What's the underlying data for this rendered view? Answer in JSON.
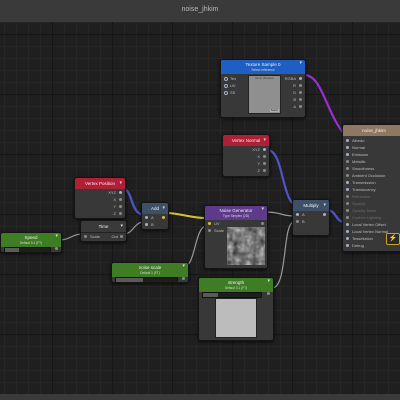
{
  "window": {
    "title": "noise_jhkim"
  },
  "nodes": {
    "texture_sample": {
      "title": "Texture Sample 0",
      "subtitle": "Select reference",
      "inputs": [
        "Tex",
        "UV",
        "SS"
      ],
      "outputs": [
        "RGBA",
        "R",
        "G",
        "B",
        "A"
      ],
      "preview_label": "None (Texture)",
      "select_label": "Select"
    },
    "output": {
      "title": "noise_jhkim",
      "inputs": [
        "Albedo",
        "Normal",
        "Emission",
        "Metallic",
        "Smoothness",
        "Ambient Occlusion",
        "Transmission",
        "Translucency",
        "Refraction",
        "Opacity",
        "Opacity Mask",
        "Custom Lighting",
        "Local Vertex Offset",
        "Local Vertex Normal",
        "Tessellation",
        "Debug"
      ]
    },
    "vertex_normal": {
      "title": "Vertex Normal",
      "outputs": [
        "XYZ",
        "X",
        "Y",
        "Z"
      ]
    },
    "vertex_position": {
      "title": "Vertex Position",
      "outputs": [
        "XYZ",
        "X",
        "Y",
        "Z"
      ]
    },
    "add": {
      "title": "Add",
      "inputs": [
        "A",
        "B"
      ]
    },
    "time": {
      "title": "Time",
      "input": "Scale",
      "output": "Out"
    },
    "speed": {
      "title": "Speed",
      "subtitle": "Default 0.1 (FT)"
    },
    "noise_generator": {
      "title": "Noise Generator",
      "subtitle": "Type Simplex (2D)",
      "inputs": [
        "UV",
        "Scale"
      ]
    },
    "noise_scale": {
      "title": "noise scale",
      "subtitle": "Default 1 (FT)"
    },
    "strength": {
      "title": "strength",
      "subtitle": "Default 0.1 (FT)"
    },
    "multiply": {
      "title": "Multiply",
      "inputs": [
        "A",
        "B"
      ]
    }
  },
  "colors": {
    "texture_header": "#1f5fc4",
    "output_header": "#8e7862",
    "vertex_header": "#b01f36",
    "add_header": "#3d5068",
    "time_header": "#3a3a3a",
    "property_header": "#3f7d25",
    "noise_header": "#5d3b8a",
    "multiply_header": "#3d5068",
    "wire_purple": "#9a2fd1",
    "wire_blue": "#4e55c9",
    "wire_yellow": "#d3c334",
    "wire_grey": "#9a9a9a"
  },
  "icons": {
    "lightning_icon": "⚡"
  }
}
